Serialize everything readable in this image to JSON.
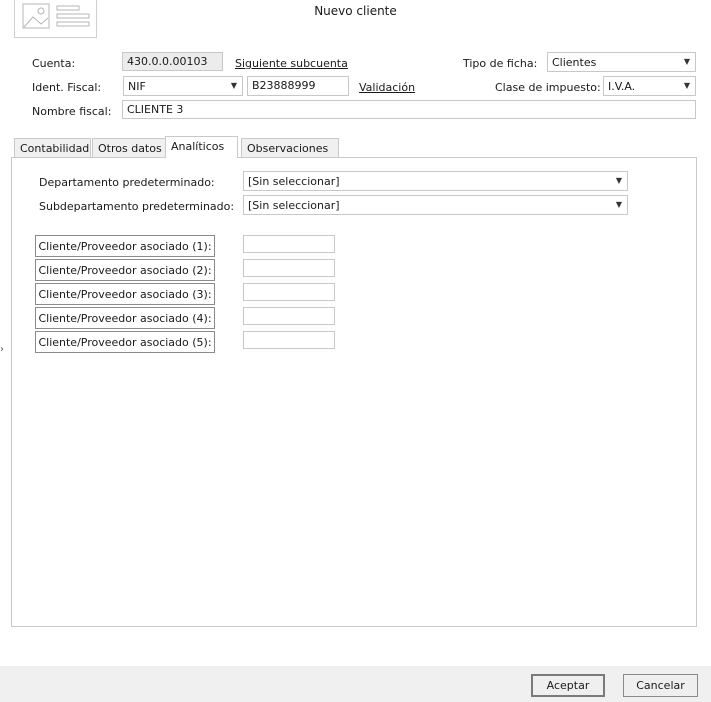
{
  "window": {
    "title": "Nuevo cliente"
  },
  "header": {
    "cuenta_label": "Cuenta:",
    "cuenta_value": "430.0.0.00103",
    "siguiente_link": "Siguiente subcuenta",
    "ident_label": "Ident. Fiscal:",
    "ident_type": "NIF",
    "ident_value": "B23888999",
    "validacion_link": "Validación",
    "nombre_label": "Nombre fiscal:",
    "nombre_value": "CLIENTE 3",
    "tipo_label": "Tipo de ficha:",
    "tipo_value": "Clientes",
    "clase_label": "Clase de impuesto:",
    "clase_value": "I.V.A."
  },
  "tabs": [
    {
      "label": "Contabilidad"
    },
    {
      "label": "Otros datos"
    },
    {
      "label": "Analíticos"
    },
    {
      "label": "Observaciones"
    }
  ],
  "analiticos": {
    "departamento_label": "Departamento predeterminado:",
    "departamento_value": "[Sin seleccionar]",
    "subdepartamento_label": "Subdepartamento predeterminado:",
    "subdepartamento_value": "[Sin seleccionar]",
    "asociados": [
      {
        "label": "Cliente/Proveedor asociado (1):",
        "value": ""
      },
      {
        "label": "Cliente/Proveedor asociado (2):",
        "value": ""
      },
      {
        "label": "Cliente/Proveedor asociado (3):",
        "value": ""
      },
      {
        "label": "Cliente/Proveedor asociado (4):",
        "value": ""
      },
      {
        "label": "Cliente/Proveedor asociado (5):",
        "value": ""
      }
    ]
  },
  "footer": {
    "accept": "Aceptar",
    "cancel": "Cancelar"
  },
  "icons": {
    "card": "card-icon",
    "dropdown": "chevron-down-icon",
    "side": "chevron-right-icon"
  }
}
